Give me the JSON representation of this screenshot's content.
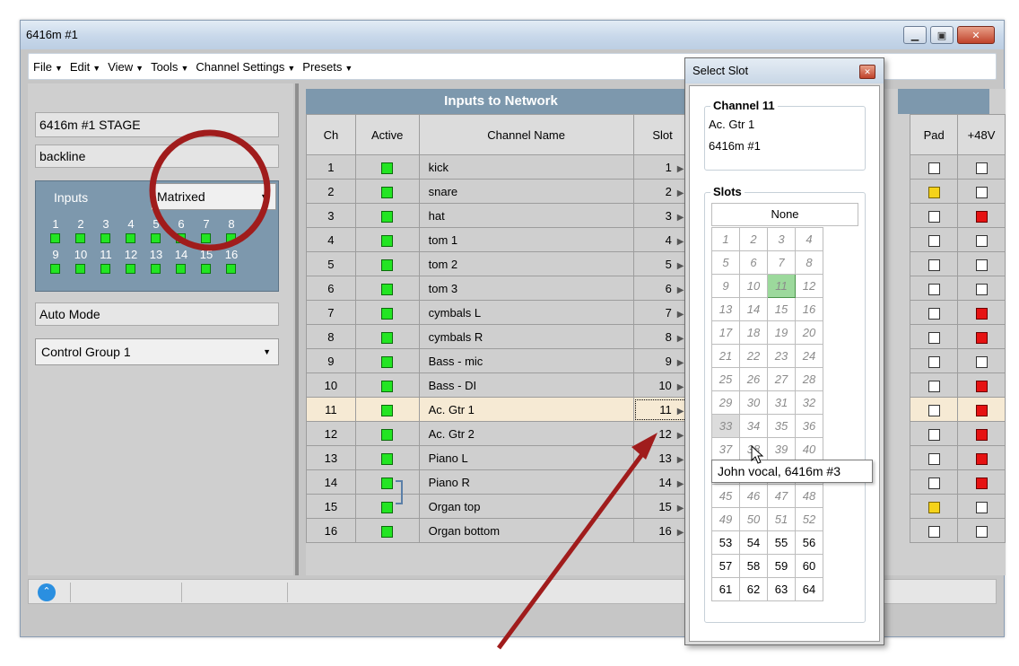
{
  "window": {
    "title": "6416m #1"
  },
  "menu": [
    {
      "label": "File"
    },
    {
      "label": "Edit"
    },
    {
      "label": "View"
    },
    {
      "label": "Tools"
    },
    {
      "label": "Channel Settings"
    },
    {
      "label": "Presets"
    }
  ],
  "left": {
    "device_name": "6416m #1 STAGE",
    "location": "backline",
    "inputs_label": "Inputs",
    "mode_select": "Matrixed",
    "led_numbers_row1": [
      "1",
      "2",
      "3",
      "4",
      "5",
      "6",
      "7",
      "8"
    ],
    "led_numbers_row2": [
      "9",
      "10",
      "11",
      "12",
      "13",
      "14",
      "15",
      "16"
    ],
    "auto_mode": "Auto Mode",
    "control_group": "Control Group 1"
  },
  "table": {
    "header": "Inputs to Network",
    "columns": {
      "ch": "Ch",
      "active": "Active",
      "name": "Channel Name",
      "slot": "Slot",
      "pad": "Pad",
      "p48": "+48V"
    },
    "rows": [
      {
        "ch": "1",
        "name": "kick",
        "slot": "1",
        "pad": "off",
        "p48": "off"
      },
      {
        "ch": "2",
        "name": "snare",
        "slot": "2",
        "pad": "yellow",
        "p48": "off"
      },
      {
        "ch": "3",
        "name": "hat",
        "slot": "3",
        "pad": "off",
        "p48": "red"
      },
      {
        "ch": "4",
        "name": "tom 1",
        "slot": "4",
        "pad": "off",
        "p48": "off"
      },
      {
        "ch": "5",
        "name": "tom 2",
        "slot": "5",
        "pad": "off",
        "p48": "off"
      },
      {
        "ch": "6",
        "name": "tom 3",
        "slot": "6",
        "pad": "off",
        "p48": "off"
      },
      {
        "ch": "7",
        "name": "cymbals L",
        "slot": "7",
        "pad": "off",
        "p48": "red"
      },
      {
        "ch": "8",
        "name": "cymbals R",
        "slot": "8",
        "pad": "off",
        "p48": "red"
      },
      {
        "ch": "9",
        "name": "Bass - mic",
        "slot": "9",
        "pad": "off",
        "p48": "off"
      },
      {
        "ch": "10",
        "name": "Bass - DI",
        "slot": "10",
        "pad": "off",
        "p48": "red"
      },
      {
        "ch": "11",
        "name": "Ac. Gtr 1",
        "slot": "11",
        "pad": "off",
        "p48": "red"
      },
      {
        "ch": "12",
        "name": "Ac. Gtr 2",
        "slot": "12",
        "pad": "off",
        "p48": "red"
      },
      {
        "ch": "13",
        "name": "Piano L",
        "slot": "13",
        "pad": "off",
        "p48": "red"
      },
      {
        "ch": "14",
        "name": "Piano R",
        "slot": "14",
        "pad": "off",
        "p48": "red"
      },
      {
        "ch": "15",
        "name": "Organ top",
        "slot": "15",
        "pad": "yellow",
        "p48": "off"
      },
      {
        "ch": "16",
        "name": "Organ bottom",
        "slot": "16",
        "pad": "off",
        "p48": "off"
      }
    ],
    "selected_row": "11"
  },
  "popup": {
    "title": "Select Slot",
    "channel_group": "Channel 11",
    "channel_name": "Ac. Gtr 1",
    "device": "6416m #1",
    "slots_group": "Slots",
    "none_label": "None",
    "current_slot": "11",
    "hover_slot": "33",
    "tooltip": "John vocal, 6416m #3",
    "slot_numbers": [
      "1",
      "2",
      "3",
      "4",
      "5",
      "6",
      "7",
      "8",
      "9",
      "10",
      "11",
      "12",
      "13",
      "14",
      "15",
      "16",
      "17",
      "18",
      "19",
      "20",
      "21",
      "22",
      "23",
      "24",
      "25",
      "26",
      "27",
      "28",
      "29",
      "30",
      "31",
      "32",
      "33",
      "34",
      "35",
      "36",
      "37",
      "38",
      "39",
      "40",
      "41",
      "42",
      "43",
      "44",
      "45",
      "46",
      "47",
      "48",
      "49",
      "50",
      "51",
      "52",
      "53",
      "54",
      "55",
      "56",
      "57",
      "58",
      "59",
      "60",
      "61",
      "62",
      "63",
      "64"
    ],
    "active_from": 53
  },
  "colors": {
    "led_green": "#23e523",
    "accent_header": "#7d98ad",
    "annotation_red": "#a01c1c"
  }
}
